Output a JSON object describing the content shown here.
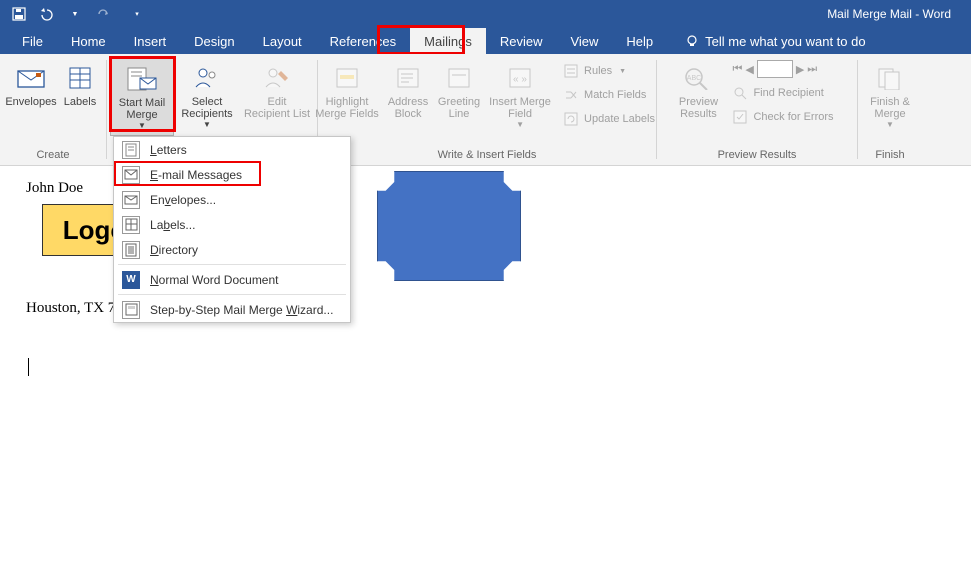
{
  "title": "Mail Merge Mail  -  Word",
  "tabs": {
    "file": "File",
    "home": "Home",
    "insert": "Insert",
    "design": "Design",
    "layout": "Layout",
    "references": "References",
    "mailings": "Mailings",
    "review": "Review",
    "view": "View",
    "help": "Help"
  },
  "tell_me": "Tell me what you want to do",
  "ribbon": {
    "create": {
      "envelopes": "Envelopes",
      "labels": "Labels",
      "group": "Create"
    },
    "start": {
      "start_mail_merge": "Start Mail\nMerge",
      "select_recipients": "Select\nRecipients",
      "edit_recipient_list": "Edit\nRecipient List"
    },
    "write_insert": {
      "highlight": "Highlight\nMerge Fields",
      "address_block": "Address\nBlock",
      "greeting_line": "Greeting\nLine",
      "insert_merge_field": "Insert Merge\nField",
      "rules": "Rules",
      "match_fields": "Match Fields",
      "update_labels": "Update Labels",
      "group": "Write & Insert Fields"
    },
    "preview": {
      "preview_results": "Preview\nResults",
      "find_recipient": "Find Recipient",
      "check_errors": "Check for Errors",
      "group": "Preview Results"
    },
    "finish": {
      "finish_merge": "Finish &\nMerge",
      "group": "Finish"
    }
  },
  "dropdown": {
    "items": [
      {
        "key": "L",
        "rest": "etters"
      },
      {
        "key": "E",
        "rest": "-mail Messages"
      },
      {
        "key": "E",
        "rest": "n",
        "key2": "v",
        "rest2": "elopes..."
      },
      {
        "key": "L",
        "rest": "a",
        "key2": "b",
        "rest2": "els..."
      },
      {
        "key": "D",
        "rest": "irectory"
      },
      {
        "key": "N",
        "rest": "ormal Word Document"
      },
      {
        "key": "W",
        "rest": "izard...",
        "prefix": "Step-by-Step Mail Merge "
      }
    ]
  },
  "doc": {
    "name": "John Doe",
    "logo": "Logo",
    "city": "Houston, TX 7"
  }
}
